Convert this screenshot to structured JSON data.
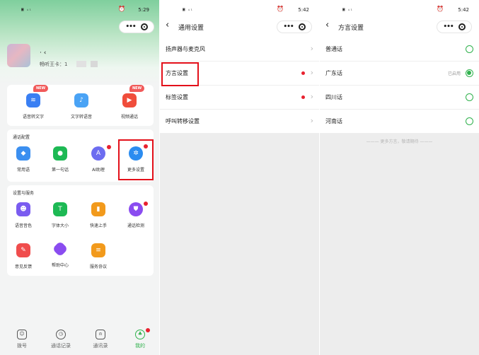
{
  "panel1": {
    "status": {
      "signal": "",
      "right": "5:29"
    },
    "user": {
      "name": "· ‹",
      "card_label": "畅听王卡：1"
    },
    "quick_actions": [
      {
        "label": "语音转文字",
        "badge": "NEW",
        "icon": "waveform-icon",
        "color": "#3a7ff3"
      },
      {
        "label": "文字转语音",
        "badge": "",
        "icon": "text-to-speech-icon",
        "color": "#4aa3f5"
      },
      {
        "label": "视频通话",
        "badge": "NEW",
        "icon": "video-call-icon",
        "color": "#f04d3b"
      }
    ],
    "call_config": {
      "title": "通话配置",
      "items": [
        {
          "label": "常用语",
          "icon": "bookmark-icon",
          "color": "#3b8ff0"
        },
        {
          "label": "第一句话",
          "icon": "chat-bubble-icon",
          "color": "#1db954"
        },
        {
          "label": "AI助理",
          "icon": "ai-assistant-icon",
          "color": "#6c6cf0"
        },
        {
          "label": "更多设置",
          "icon": "gear-icon",
          "color": "#2b8cf0"
        }
      ]
    },
    "services": {
      "title": "设置与服务",
      "items": [
        {
          "label": "语音音色",
          "icon": "voice-person-icon",
          "color": "#7a5cf0"
        },
        {
          "label": "字体大小",
          "icon": "font-size-icon",
          "color": "#1db954"
        },
        {
          "label": "快速上手",
          "icon": "quick-start-icon",
          "color": "#f29a1c"
        },
        {
          "label": "通话检测",
          "icon": "shield-check-icon",
          "color": "#8a4cf0"
        },
        {
          "label": "意见反馈",
          "icon": "feedback-icon",
          "color": "#f04d4d"
        },
        {
          "label": "帮助中心",
          "icon": "help-center-icon",
          "color": "#8a4cf0"
        },
        {
          "label": "服务协议",
          "icon": "agreement-icon",
          "color": "#f29a1c"
        }
      ]
    },
    "nav": [
      {
        "label": "拨号",
        "icon": "dialpad-icon"
      },
      {
        "label": "通话记录",
        "icon": "clock-icon"
      },
      {
        "label": "通讯录",
        "icon": "contacts-icon"
      },
      {
        "label": "我的",
        "icon": "profile-icon"
      }
    ]
  },
  "panel2": {
    "status": {
      "right": "5:42"
    },
    "title": "通用设置",
    "rows": [
      {
        "label": "扬声器与麦克风",
        "dot": false
      },
      {
        "label": "方言设置",
        "dot": true
      },
      {
        "label": "标签设置",
        "dot": true
      },
      {
        "label": "呼叫转移设置",
        "dot": false
      }
    ]
  },
  "panel3": {
    "status": {
      "right": "5:42"
    },
    "title": "方言设置",
    "rows": [
      {
        "label": "普通话",
        "selected": false,
        "tag": ""
      },
      {
        "label": "广东话",
        "selected": true,
        "tag": "已启用"
      },
      {
        "label": "四川话",
        "selected": false,
        "tag": ""
      },
      {
        "label": "河南话",
        "selected": false,
        "tag": ""
      }
    ],
    "more_text": "——— 更多方言，敬请期待 ———"
  },
  "colors": {
    "accent": "#2fb14c",
    "highlight": "#e3101a",
    "dot": "#e8212f"
  }
}
